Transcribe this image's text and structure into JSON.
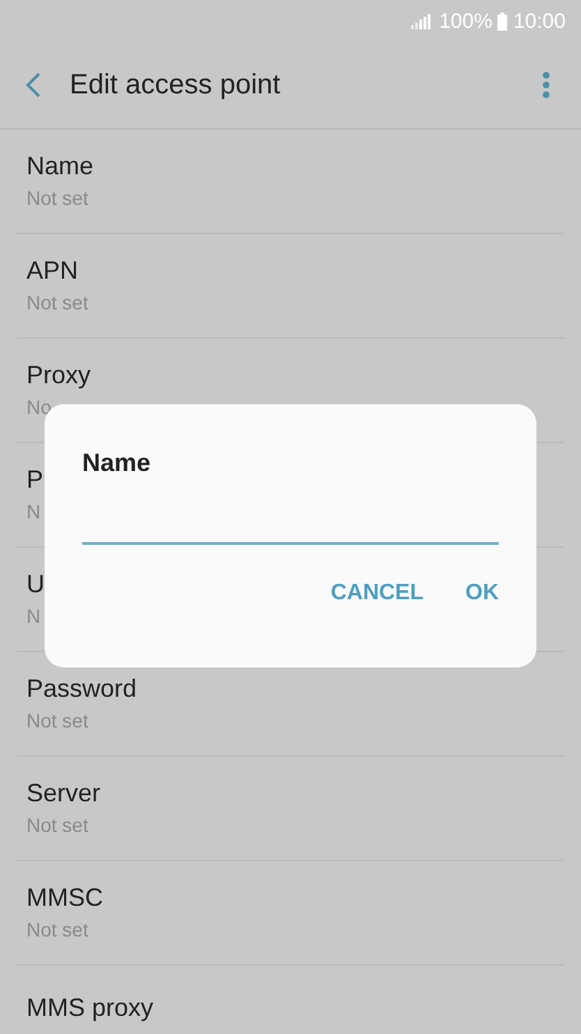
{
  "status_bar": {
    "battery": "100%",
    "time": "10:00"
  },
  "app_bar": {
    "title": "Edit access point"
  },
  "settings": [
    {
      "title": "Name",
      "value": "Not set"
    },
    {
      "title": "APN",
      "value": "Not set"
    },
    {
      "title": "Proxy",
      "value": "No"
    },
    {
      "title": "P",
      "value": "N"
    },
    {
      "title": "U",
      "value": "N"
    },
    {
      "title": "Password",
      "value": "Not set"
    },
    {
      "title": "Server",
      "value": "Not set"
    },
    {
      "title": "MMSC",
      "value": "Not set"
    },
    {
      "title": "MMS proxy"
    }
  ],
  "dialog": {
    "title": "Name",
    "buttons": [
      "CANCEL",
      "OK"
    ]
  }
}
